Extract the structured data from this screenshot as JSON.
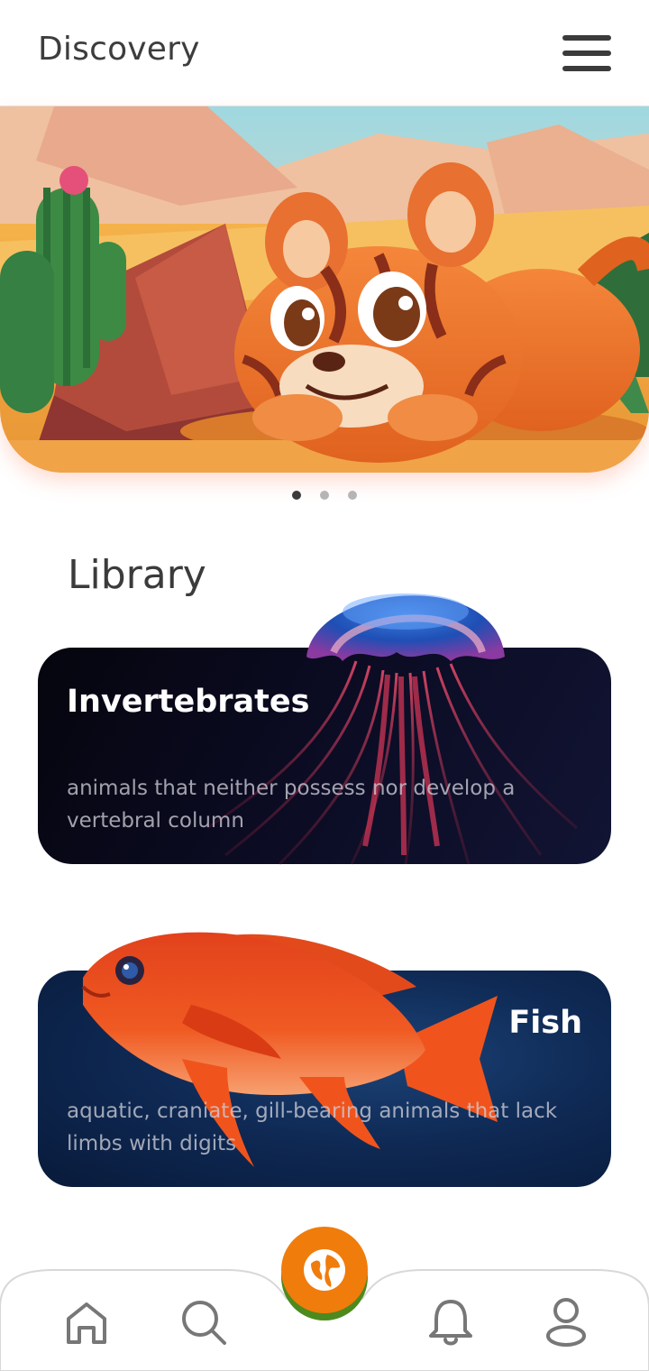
{
  "header": {
    "title": "Discovery",
    "menu_icon": "hamburger-menu-icon"
  },
  "hero": {
    "slides_count": 3,
    "active_slide": 1,
    "illustration": "cartoon tiger cub in desert"
  },
  "library": {
    "title": "Library",
    "cards": [
      {
        "title": "Invertebrates",
        "description": "animals that neither possess nor develop a vertebral column"
      },
      {
        "title": "Fish",
        "description": "aquatic, craniate, gill-bearing animals that lack limbs with digits"
      }
    ]
  },
  "nav": {
    "items": [
      "home-icon",
      "search-icon",
      "globe-icon",
      "bell-icon",
      "profile-icon"
    ],
    "active": "globe-icon"
  },
  "colors": {
    "accent": "#f07c0c",
    "accent_green": "#4c8a1e",
    "text": "#3b3b3b"
  }
}
